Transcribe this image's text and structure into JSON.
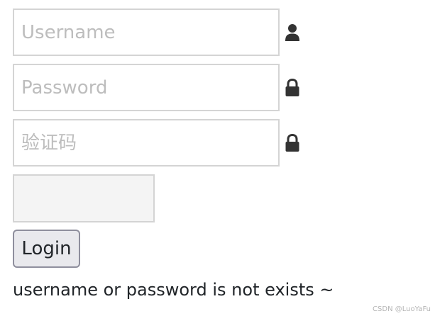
{
  "form": {
    "username": {
      "placeholder": "Username",
      "value": "",
      "icon": "user-icon"
    },
    "password": {
      "placeholder": "Password",
      "value": "",
      "icon": "lock-icon"
    },
    "captcha": {
      "placeholder": "验证码",
      "value": "",
      "icon": "lock-icon"
    },
    "login_label": "Login",
    "error_message": "username or password is not exists ~"
  },
  "watermark": "CSDN @LuoYaFu",
  "colors": {
    "field_border": "#d4d4d4",
    "placeholder": "#bdbdbd",
    "icon": "#333333",
    "captcha_bg": "#f4f4f4",
    "button_bg": "#e9e9ed",
    "button_border": "#8f8f9d"
  }
}
